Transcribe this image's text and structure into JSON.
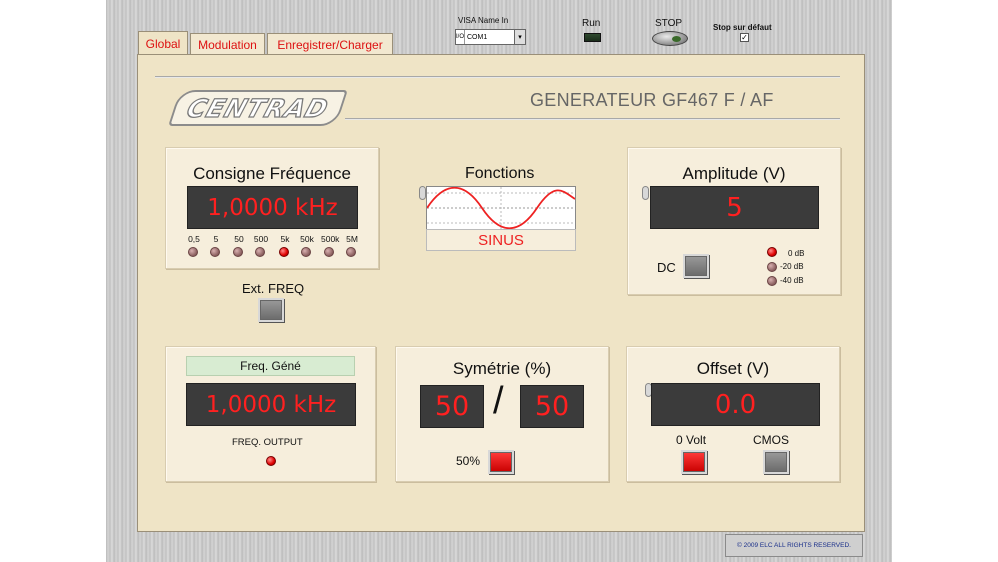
{
  "header": {
    "visa_label": "VISA Name In",
    "visa_value": "COM1",
    "visa_io": "I/O",
    "run_label": "Run",
    "stop_label": "STOP",
    "stop_on_error_label": "Stop sur défaut",
    "stop_on_error_checked": "✓"
  },
  "tabs": [
    {
      "label": "Global"
    },
    {
      "label": "Modulation"
    },
    {
      "label": "Enregistrer/Charger"
    }
  ],
  "logo_text": "CENTRAD",
  "device_title": "GENERATEUR  GF467 F / AF",
  "frequency": {
    "title": "Consigne Fréquence",
    "display": "1,0000 kHz",
    "ranges": [
      "0,5",
      "5",
      "50",
      "500",
      "5k",
      "50k",
      "500k",
      "5M"
    ],
    "active_range": "5k",
    "ext_label": "Ext. FREQ"
  },
  "functions": {
    "title": "Fonctions",
    "value": "SINUS"
  },
  "amplitude": {
    "title": "Amplitude (V)",
    "display": "5",
    "dc_label": "DC",
    "attenuations": [
      "0 dB",
      "-20 dB",
      "-40 dB"
    ],
    "active_attenuation": "0 dB"
  },
  "freq_output": {
    "header": "Freq. Géné",
    "display": "1,0000 kHz",
    "label": "FREQ. OUTPUT"
  },
  "symmetry": {
    "title": "Symétrie (%)",
    "left": "50",
    "separator": "/",
    "right": "50",
    "button_label": "50%"
  },
  "offset": {
    "title": "Offset (V)",
    "display": "0.0",
    "zero_volt_label": "0 Volt",
    "cmos_label": "CMOS"
  },
  "footer": "© 2009 ELC  ALL RIGHTS RESERVED.",
  "colors": {
    "panel": "#efe4c6",
    "display_bg": "#3b3b3b",
    "display_text": "#ff2020",
    "tab_text": "#dd1111"
  }
}
